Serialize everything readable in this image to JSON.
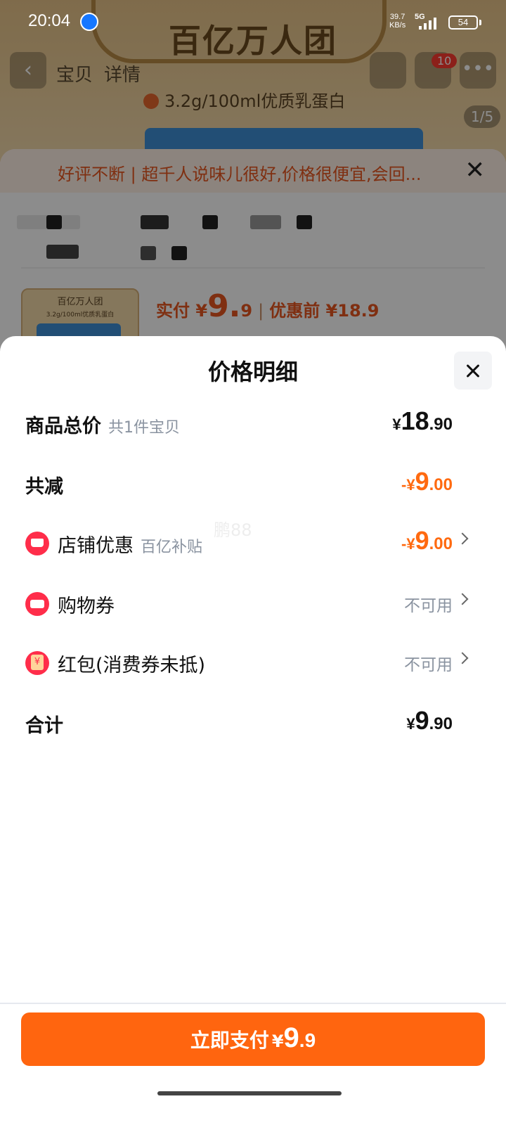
{
  "status_bar": {
    "time": "20:04",
    "net_speed_value": "39.7",
    "net_speed_unit": "KB/s",
    "network": "5G",
    "battery": "54"
  },
  "background": {
    "hero_title": "百亿万人团",
    "tabs": [
      "宝贝",
      "详情"
    ],
    "cart_count": "10",
    "protein_text": "3.2g/100ml优质乳蛋白",
    "image_pager": "1/5",
    "review_banner": "好评不断 | 超千人说味儿很好,价格很便宜,会回...",
    "thumb_title": "百亿万人团",
    "thumb_sub": "3.2g/100ml优质乳蛋白",
    "price_label": "实付 ¥",
    "price_int": "9.",
    "price_dec": "9",
    "original_label": "优惠前 ¥18.9"
  },
  "sheet": {
    "title": "价格明细",
    "watermark": "鹏88",
    "rows": [
      {
        "label": "商品总价",
        "sub": "共1件宝贝",
        "prefix": "¥",
        "int": "18",
        "dec": ".90"
      },
      {
        "label": "共减",
        "sub": "",
        "prefix": "-¥",
        "int": "9",
        "dec": ".00"
      },
      {
        "label": "店铺优惠",
        "sub": "百亿补贴",
        "prefix": "-¥",
        "int": "9",
        "dec": ".00",
        "icon": "store-icon"
      },
      {
        "label": "购物券",
        "sub": "",
        "value": "不可用",
        "icon": "coupon-icon"
      },
      {
        "label": "红包(消费券未抵)",
        "sub": "",
        "value": "不可用",
        "icon": "red-packet-icon"
      },
      {
        "label": "合计",
        "sub": "",
        "prefix": "¥",
        "int": "9",
        "dec": ".90"
      }
    ],
    "pay_button": {
      "label": "立即支付",
      "prefix": "¥",
      "int": "9",
      "dec": ".9"
    }
  },
  "colors": {
    "accent_orange": "#ff650f",
    "discount_orange": "#ff6a10",
    "icon_red": "#ff2d4a"
  }
}
